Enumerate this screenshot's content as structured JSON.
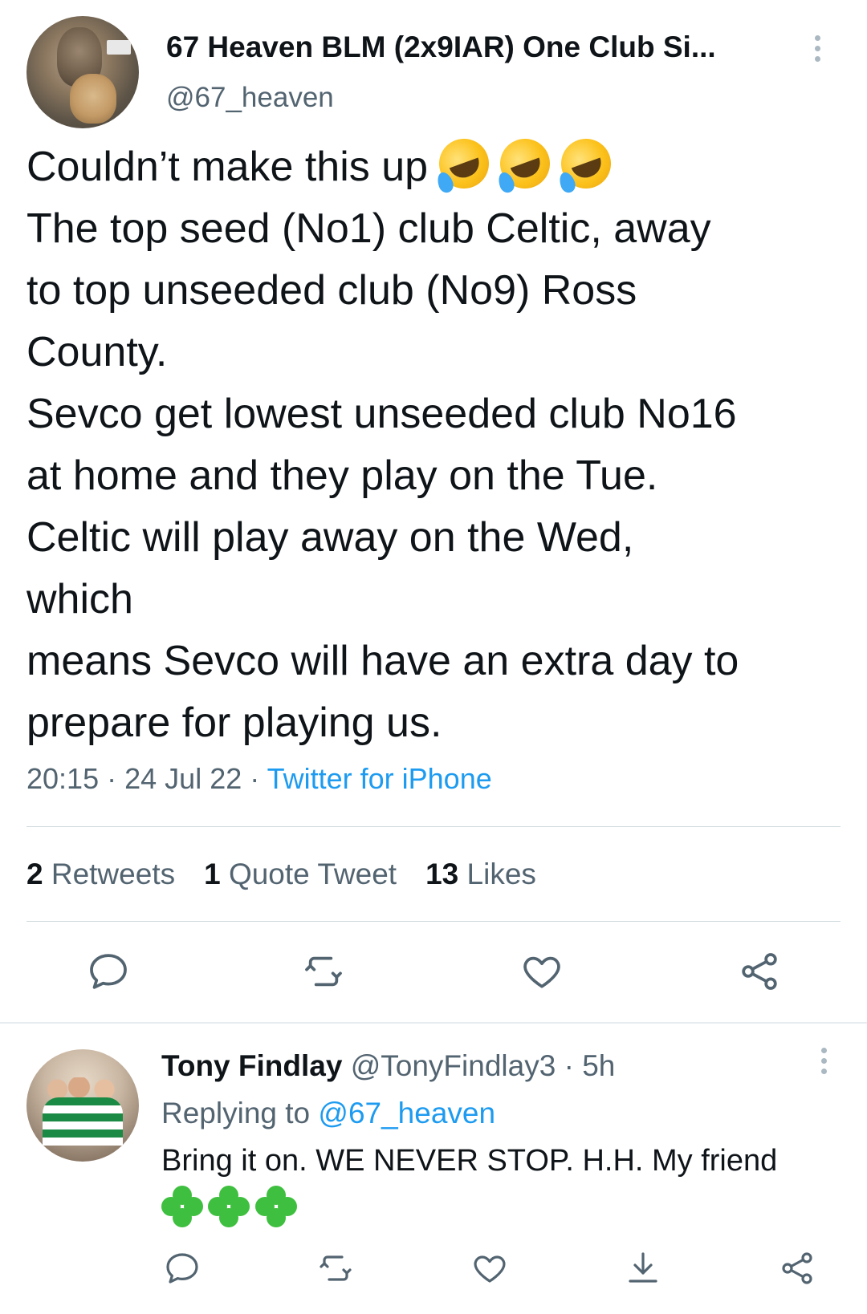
{
  "tweet": {
    "author": {
      "display_name": "67 Heaven BLM (2x9IAR) One Club Si...",
      "handle": "@67_heaven"
    },
    "text_lines": [
      "Couldn’t make this up",
      "The top seed (No1) club Celtic, away",
      "to top unseeded club (No9) Ross",
      "County.",
      "Sevco get lowest unseeded club No16",
      "at home and they play on the Tue.",
      "Celtic will play away on the Wed,",
      "which",
      "means Sevco will have an extra day to",
      "prepare for playing us."
    ],
    "emoji_icon": "rolling-on-floor-laughing-emoji",
    "time": "20:15",
    "separator": "·",
    "date": "24 Jul 22",
    "source": "Twitter for iPhone",
    "stats": {
      "retweets_count": "2",
      "retweets_label": "Retweets",
      "quotes_count": "1",
      "quotes_label": "Quote Tweet",
      "likes_count": "13",
      "likes_label": "Likes"
    }
  },
  "reply": {
    "display_name": "Tony Findlay",
    "handle": "@TonyFindlay3",
    "separator": "·",
    "age": "5h",
    "replying_to_label": "Replying to",
    "replying_to_handle": "@67_heaven",
    "text": "Bring it on. WE NEVER STOP. H.H. My friend",
    "emoji_icon": "shamrock-emoji"
  },
  "colors": {
    "link_blue": "#1d9bf0",
    "secondary_text": "#536471",
    "primary_text": "#0f1419",
    "divider": "#cfd9de"
  }
}
